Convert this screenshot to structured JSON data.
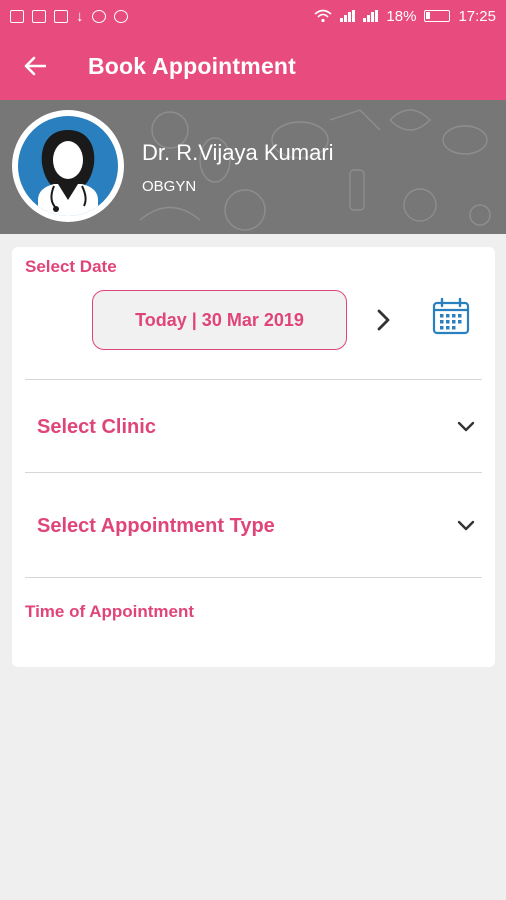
{
  "status_bar": {
    "battery": "18%",
    "time": "17:25",
    "left_icons": [
      "message-icon",
      "alert-icon",
      "image-icon",
      "download-icon",
      "chat-icon",
      "dnd-icon"
    ],
    "right_icons": [
      "wifi-icon",
      "signal-icon",
      "signal-icon",
      "battery-icon"
    ]
  },
  "app_bar": {
    "title": "Book Appointment",
    "back_icon": "arrow-left-icon"
  },
  "doctor": {
    "name": "Dr. R.Vijaya Kumari",
    "specialty": "OBGYN"
  },
  "form": {
    "select_date_label": "Select Date",
    "date_value": "Today | 30 Mar 2019",
    "clinic_placeholder": "Select Clinic",
    "appointment_type_placeholder": "Select Appointment Type",
    "time_label": "Time of Appointment"
  },
  "colors": {
    "primary": "#e84b7e",
    "accent_text": "#e0457a",
    "calendar_icon": "#2a7fbf",
    "background": "#efefef"
  }
}
